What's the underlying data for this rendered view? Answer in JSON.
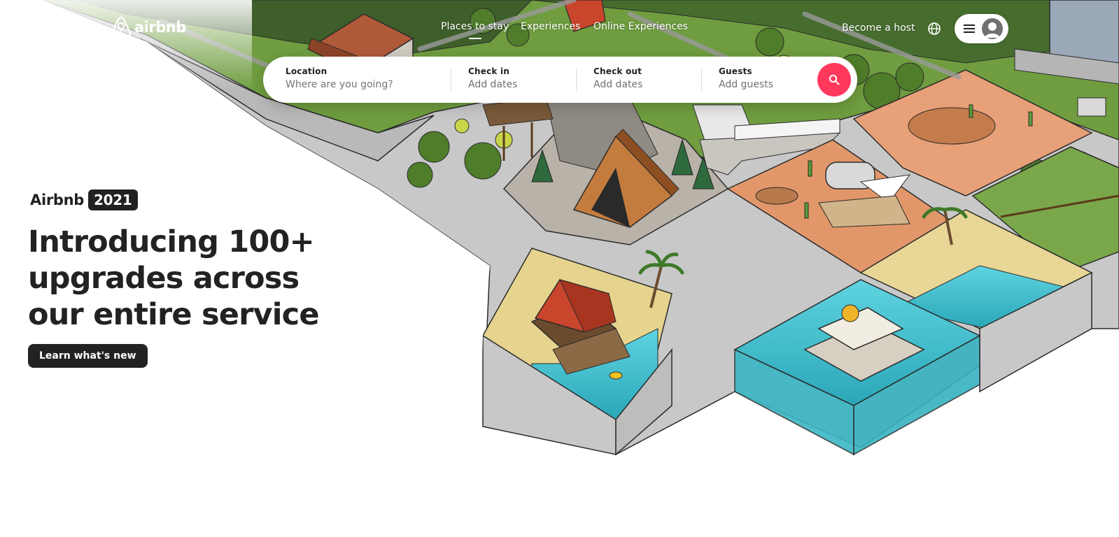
{
  "header": {
    "logo_text": "airbnb",
    "nav": [
      {
        "label": "Places to stay",
        "active": true
      },
      {
        "label": "Experiences",
        "active": false
      },
      {
        "label": "Online Experiences",
        "active": false
      }
    ],
    "become_host": "Become a host",
    "globe_icon": "globe-icon",
    "menu_icon": "hamburger-menu-icon",
    "avatar_icon": "user-avatar-icon"
  },
  "search": {
    "location_label": "Location",
    "location_placeholder": "Where are you going?",
    "checkin_label": "Check in",
    "checkin_value": "Add dates",
    "checkout_label": "Check out",
    "checkout_value": "Add dates",
    "guests_label": "Guests",
    "guests_value": "Add guests",
    "button_icon": "search-icon"
  },
  "hero": {
    "brand": "Airbnb",
    "year": "2021",
    "headline": "Introducing 100+ upgrades across our entire service",
    "cta": "Learn what's new"
  },
  "colors": {
    "brand": "#ff385c",
    "text_dark": "#222222",
    "text_muted": "#717171"
  }
}
